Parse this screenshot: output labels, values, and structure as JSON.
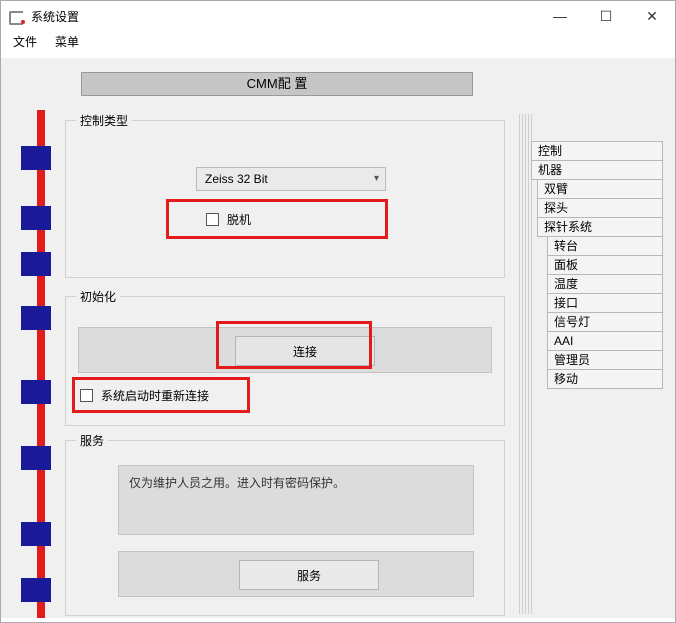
{
  "window": {
    "title": "系统设置"
  },
  "menu": {
    "file": "文件",
    "menu": "菜单"
  },
  "header": {
    "title": "CMM配 置"
  },
  "controlType": {
    "legend": "控制类型",
    "selected": "Zeiss 32 Bit",
    "offline_label": "脱机"
  },
  "init": {
    "legend": "初始化",
    "connect_label": "连接",
    "reconnect_label": "系统启动时重新连接"
  },
  "service": {
    "legend": "服务",
    "desc": "仅为维护人员之用。进入时有密码保护。",
    "button_label": "服务"
  },
  "sideTabs": {
    "t0": "控制",
    "t1": "机器",
    "t2": "双臂",
    "t3": "探头",
    "t4": "探针系统",
    "t5": "转台",
    "t6": "面板",
    "t7": "温度",
    "t8": "接口",
    "t9": "信号灯",
    "t10": "AAI",
    "t11": "管理员",
    "t12": "移动"
  }
}
